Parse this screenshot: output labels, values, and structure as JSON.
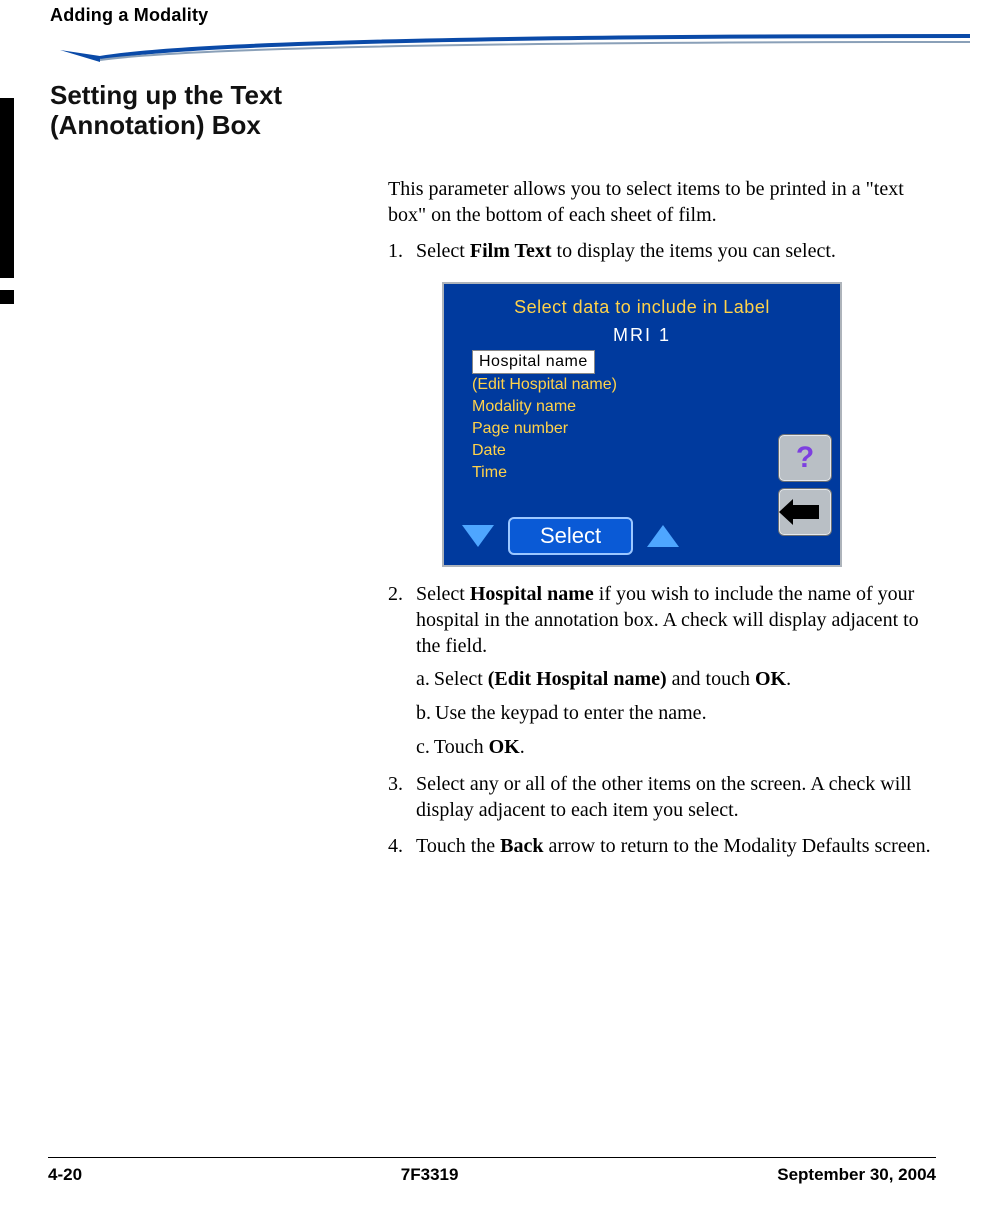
{
  "header": {
    "running_head": "Adding a Modality"
  },
  "section": {
    "title_line1": "Setting up the Text",
    "title_line2": "(Annotation) Box"
  },
  "body": {
    "intro": "This parameter allows you to select items to be printed in a \"text box\" on the bottom of each sheet of film.",
    "step1_num": "1.",
    "step1_pre": "Select ",
    "step1_bold": "Film Text",
    "step1_post": " to display the items you can select.",
    "step2_num": "2.",
    "step2_pre": "Select ",
    "step2_bold": "Hospital name",
    "step2_post": " if you wish to include the name of your hospital in the annotation box. A check will display adjacent to the field.",
    "step2a_lbl": "a.",
    "step2a_pre": "Select ",
    "step2a_bold1": "(Edit Hospital name)",
    "step2a_mid": " and touch ",
    "step2a_bold2": "OK",
    "step2a_post": ".",
    "step2b_lbl": "b.",
    "step2b_text": "Use the keypad to enter the name.",
    "step2c_lbl": "c.",
    "step2c_pre": "Touch ",
    "step2c_bold": "OK",
    "step2c_post": ".",
    "step3_num": "3.",
    "step3_text": "Select any or all of the other items on the screen. A check will display adjacent to each item you select.",
    "step4_num": "4.",
    "step4_pre": "Touch the ",
    "step4_bold": "Back",
    "step4_post": " arrow to return to the Modality Defaults screen."
  },
  "device": {
    "title": "Select data to include in Label",
    "mri": "MRI 1",
    "items": {
      "selected": "Hospital name",
      "edit": "(Edit Hospital name)",
      "modality": "Modality name",
      "page": "Page number",
      "date": "Date",
      "time": "Time"
    },
    "select_btn": "Select"
  },
  "footer": {
    "left": "4-20",
    "center": "7F3319",
    "right": "September 30, 2004"
  }
}
